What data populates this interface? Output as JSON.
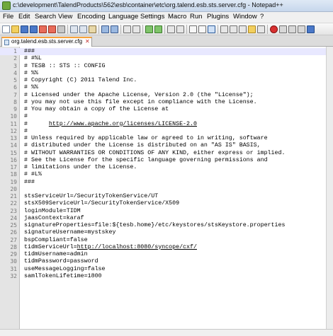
{
  "window": {
    "title": "c:\\development\\TalendProducts\\562\\esb\\container\\etc\\org.talend.esb.sts.server.cfg - Notepad++"
  },
  "menu": [
    "File",
    "Edit",
    "Search",
    "View",
    "Encoding",
    "Language",
    "Settings",
    "Macro",
    "Run",
    "Plugins",
    "Window",
    "?"
  ],
  "tab": {
    "label": "org.talend.esb.sts.server.cfg",
    "close": "✕"
  },
  "editor": {
    "active_line": 1,
    "lines": [
      "###",
      "# #%L",
      "# TESB :: STS :: CONFIG",
      "# %%",
      "# Copyright (C) 2011 Talend Inc.",
      "# %%",
      "# Licensed under the Apache License, Version 2.0 (the \"License\");",
      "# you may not use this file except in compliance with the License.",
      "# You may obtain a copy of the License at",
      "#",
      "#      http://www.apache.org/licenses/LICENSE-2.0",
      "#",
      "# Unless required by applicable law or agreed to in writing, software",
      "# distributed under the License is distributed on an \"AS IS\" BASIS,",
      "# WITHOUT WARRANTIES OR CONDITIONS OF ANY KIND, either express or implied.",
      "# See the License for the specific language governing permissions and",
      "# limitations under the License.",
      "# #L%",
      "###",
      "",
      "stsServiceUrl=/SecurityTokenService/UT",
      "stsX509ServiceUrl=/SecurityTokenService/X509",
      "loginModule=TIDM",
      "jaasContext=karaf",
      "signatureProperties=file:${tesb.home}/etc/keystores/stsKeystore.properties",
      "signatureUsername=mystskey",
      "bspCompliant=false",
      "tidmServiceUrl=http://localhost:8080/syncope/cxf/",
      "tidmUsername=admin",
      "tidmPassword=password",
      "useMessageLogging=false",
      "samlTokenLifetime=1800"
    ]
  },
  "toolbar_icons": [
    "new-file",
    "open-file",
    "save",
    "save-all",
    "close",
    "close-all",
    "print",
    "cut",
    "copy",
    "paste",
    "undo",
    "redo",
    "find",
    "replace",
    "zoom-in",
    "zoom-out",
    "sync-v",
    "sync-h",
    "word-wrap",
    "all-chars",
    "indent-guide",
    "user-lang",
    "doc-map",
    "function-list",
    "folder-workspace",
    "monitor",
    "record-macro",
    "stop-macro",
    "play-macro",
    "run-macro-multi",
    "save-macro"
  ]
}
